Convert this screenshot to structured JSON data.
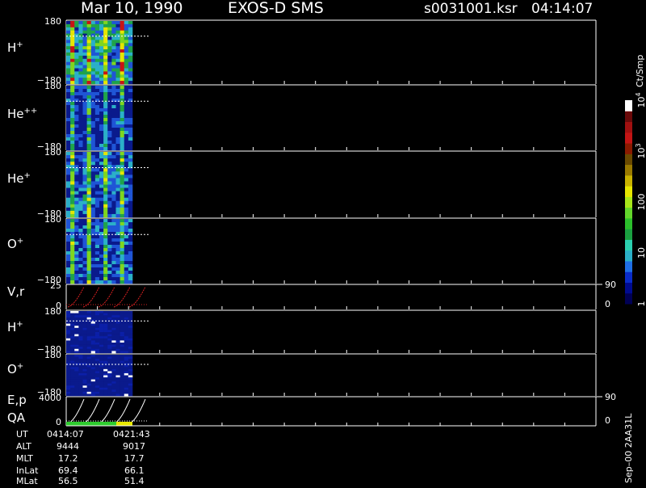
{
  "header": {
    "date": "Mar 10, 1990",
    "instrument": "EXOS-D  SMS",
    "file": "s0031001.ksr",
    "time": "04:14:07"
  },
  "colors": {
    "background": "#000000",
    "axis": "#ffffff",
    "heat_low": "#0a1a8c",
    "heat_mid": "#1fa34a",
    "heat_yellow": "#e6e600",
    "heat_red": "#c81414",
    "pitch_curve": "#d62020",
    "energy_curve": "#ffffff",
    "qa_green": "#2ecc2e",
    "qa_yellow": "#e8e800"
  },
  "colorbar": {
    "unit": "Ct/Smp",
    "ticks": [
      {
        "label": "1",
        "pos": 0.0
      },
      {
        "label": "10",
        "pos": 0.25
      },
      {
        "label": "100",
        "pos": 0.5
      },
      {
        "label": "10",
        "sup": "3",
        "pos": 0.75
      },
      {
        "label": "10",
        "sup": "4",
        "pos": 1.0
      }
    ],
    "colors": [
      "#000055",
      "#000b8f",
      "#0a2cc9",
      "#1f6fe6",
      "#2bb0c8",
      "#2bd0b0",
      "#1aa040",
      "#2bbf2b",
      "#63d62b",
      "#a8e61a",
      "#e6e600",
      "#c9b200",
      "#9a7a00",
      "#6a4a00",
      "#8a1a00",
      "#c21414",
      "#a01010",
      "#6a0a0a",
      "#ffffff"
    ]
  },
  "chart_data": [
    {
      "type": "heatmap",
      "name": "H",
      "sup": "+",
      "ylabel": "H+",
      "ylim": [
        -180,
        180
      ],
      "ytick_top": "180",
      "ytick_bottom": "−180",
      "intensity": "high"
    },
    {
      "type": "heatmap",
      "name": "He",
      "sup": "++",
      "ylabel": "He++",
      "ylim": [
        -180,
        180
      ],
      "ytick_top": "180",
      "ytick_bottom": "−180",
      "intensity": "low"
    },
    {
      "type": "heatmap",
      "name": "He",
      "sup": "+",
      "ylabel": "He+",
      "ylim": [
        -180,
        180
      ],
      "ytick_top": "180",
      "ytick_bottom": "−180",
      "intensity": "med"
    },
    {
      "type": "heatmap",
      "name": "O",
      "sup": "+",
      "ylabel": "O+",
      "ylim": [
        -180,
        180
      ],
      "ytick_top": "180",
      "ytick_bottom": "−180",
      "intensity": "lowmed"
    },
    {
      "type": "line",
      "name": "V,r",
      "ylim": [
        0,
        25
      ],
      "ytick_top": "25",
      "ytick_bottom": "0",
      "right_top": "90",
      "right_bottom": "0"
    },
    {
      "type": "heatmap",
      "name": "H",
      "sup": "+",
      "ylabel": "H+",
      "ylim": [
        -180,
        180
      ],
      "ytick_top": "180",
      "ytick_bottom": "−180",
      "intensity": "sparse"
    },
    {
      "type": "heatmap",
      "name": "O",
      "sup": "+",
      "ylabel": "O+",
      "ylim": [
        -180,
        180
      ],
      "ytick_top": "180",
      "ytick_bottom": "−180",
      "intensity": "sparse"
    },
    {
      "type": "line",
      "name": "E,p",
      "name2": "QA",
      "ylim": [
        0,
        4000
      ],
      "ytick_top": "4000",
      "ytick_bottom": "0",
      "right_top": "90",
      "right_bottom": "0"
    }
  ],
  "footer": {
    "rows": [
      {
        "label": "UT",
        "v1": "0414:07",
        "v2": "0421:43"
      },
      {
        "label": "ALT",
        "v1": "9444",
        "v2": "9017"
      },
      {
        "label": "MLT",
        "v1": "17.2",
        "v2": "17.7"
      },
      {
        "label": "InLat",
        "v1": "69.4",
        "v2": "66.1"
      },
      {
        "label": "MLat",
        "v1": "56.5",
        "v2": "51.4"
      }
    ],
    "side_text": "Sep–00  2AA31L"
  }
}
